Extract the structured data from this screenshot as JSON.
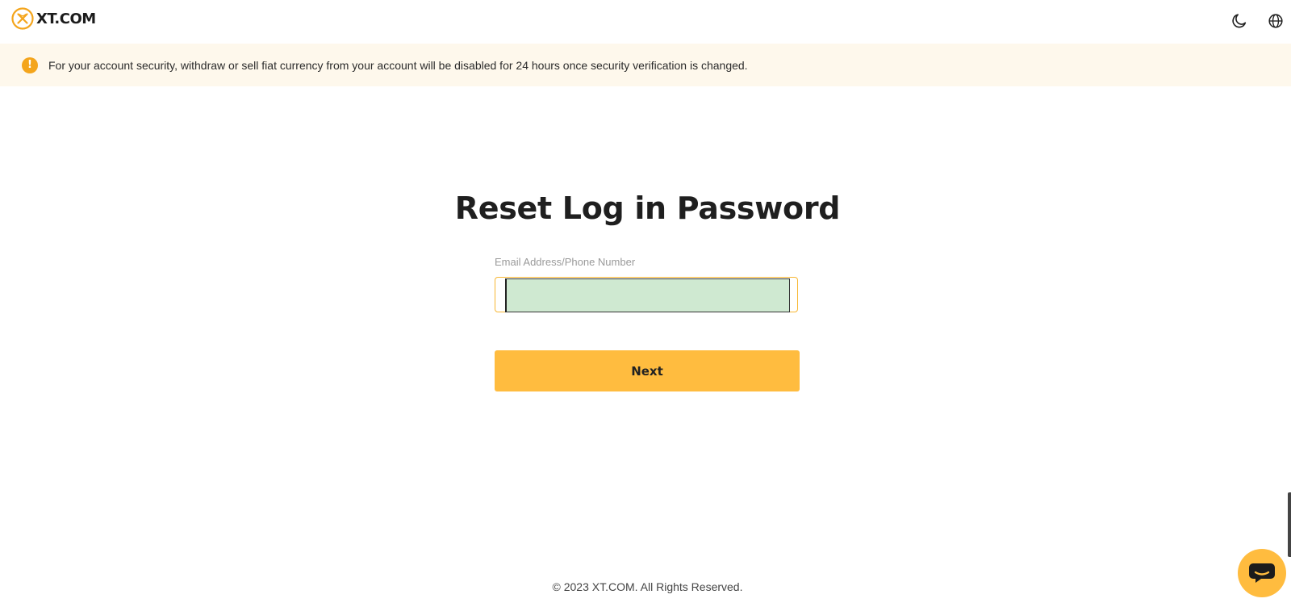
{
  "header": {
    "logo_text": "XT.COM",
    "theme_icon": "moon-icon",
    "language_icon": "globe-icon"
  },
  "notice": {
    "icon": "warning-icon",
    "text": "For your account security, withdraw or sell fiat currency from your account will be disabled for 24 hours once security verification is changed."
  },
  "form": {
    "title": "Reset Log in Password",
    "field_label": "Email Address/Phone Number",
    "field_value": "",
    "field_placeholder": "",
    "next_label": "Next"
  },
  "footer": {
    "copyright": "© 2023 XT.COM. All Rights Reserved."
  },
  "chat": {
    "icon": "chat-bubble-icon"
  },
  "colors": {
    "accent": "#ffbc3f",
    "notice_bg": "#fef8ec",
    "warning": "#f4a51c",
    "input_fill": "#cfe9d1"
  }
}
